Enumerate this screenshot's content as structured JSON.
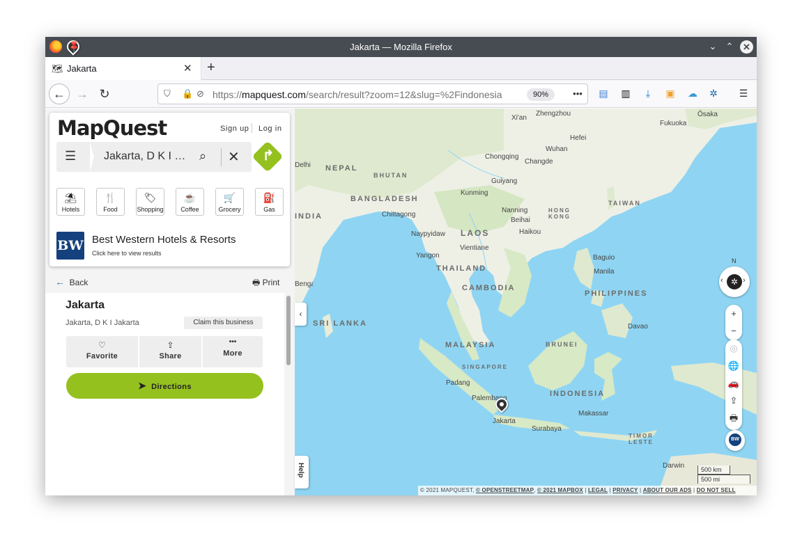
{
  "window": {
    "title": "Jakarta — Mozilla Firefox",
    "pin_icon": "pin-icon",
    "min_icon": "⌄",
    "max_icon": "⌃",
    "close_icon": "✕"
  },
  "tab": {
    "label": "Jakarta",
    "close": "✕",
    "new_tab": "+"
  },
  "nav": {
    "url_prefix": "https://",
    "url_domain": "mapquest.com",
    "url_path": "/search/result?zoom=12&slug=%2Findonesia",
    "zoom": "90%",
    "more": "•••"
  },
  "mapquest": {
    "logo": "MapQuest",
    "sign_up": "Sign up",
    "log_in": "Log in",
    "search_value": "Jakarta, D K I  …",
    "categories": [
      {
        "label": "Hotels",
        "icon": "⛱"
      },
      {
        "label": "Food",
        "icon": "🍴"
      },
      {
        "label": "Shopping",
        "icon": "🏷"
      },
      {
        "label": "Coffee",
        "icon": "☕"
      },
      {
        "label": "Grocery",
        "icon": "🛒"
      },
      {
        "label": "Gas",
        "icon": "⛽"
      }
    ],
    "ad": {
      "logo": "BW",
      "title": "Best Western Hotels & Resorts",
      "subtitle": "Click here to view results"
    },
    "back": "Back",
    "print": "Print",
    "place": {
      "name": "Jakarta",
      "address": "Jakarta, D K I Jakarta",
      "claim": "Claim this business"
    },
    "actions": [
      {
        "label": "Favorite",
        "icon": "♡"
      },
      {
        "label": "Share",
        "icon": "⇪"
      },
      {
        "label": "More",
        "icon": "•••"
      }
    ],
    "directions": "Directions",
    "help": "Help"
  },
  "map": {
    "countries": [
      "NEPAL",
      "BHUTAN",
      "BANGLADESH",
      "INDIA",
      "LAOS",
      "THAILAND",
      "CAMBODIA",
      "PHILIPPINES",
      "MALAYSIA",
      "BRUNEI",
      "SINGAPORE",
      "INDONESIA",
      "TAIWAN",
      "HONG KONG",
      "TIMOR LESTE",
      "SRI LANKA"
    ],
    "cities": [
      "Zhengzhou",
      "Xi'an",
      "Ōsaka",
      "Fukuoka",
      "Hefei",
      "Wuhan",
      "Chongqing",
      "Changde",
      "Delhi",
      "Guiyang",
      "Kunming",
      "Nanning",
      "Beihai",
      "Haikou",
      "Chittagong",
      "Naypyidaw",
      "Vientiane",
      "Yangon",
      "Baguio",
      "Manila",
      "Davao",
      "Padang",
      "Palembang",
      "Jakarta",
      "Surabaya",
      "Makassar",
      "Darwin",
      "Bengaluru"
    ],
    "compass_n": "N",
    "zoom_in": "+",
    "zoom_out": "−",
    "scale_km": "500 km",
    "scale_mi": "500 mi",
    "attribution": {
      "copyright": "© 2021 MAPQUEST,",
      "osm": "© OPENSTREETMAP",
      "mapbox": "© 2021 MAPBOX",
      "legal": "LEGAL",
      "privacy": "PRIVACY",
      "about_ads": "ABOUT OUR ADS",
      "do_not_sell": "DO NOT SELL"
    }
  }
}
